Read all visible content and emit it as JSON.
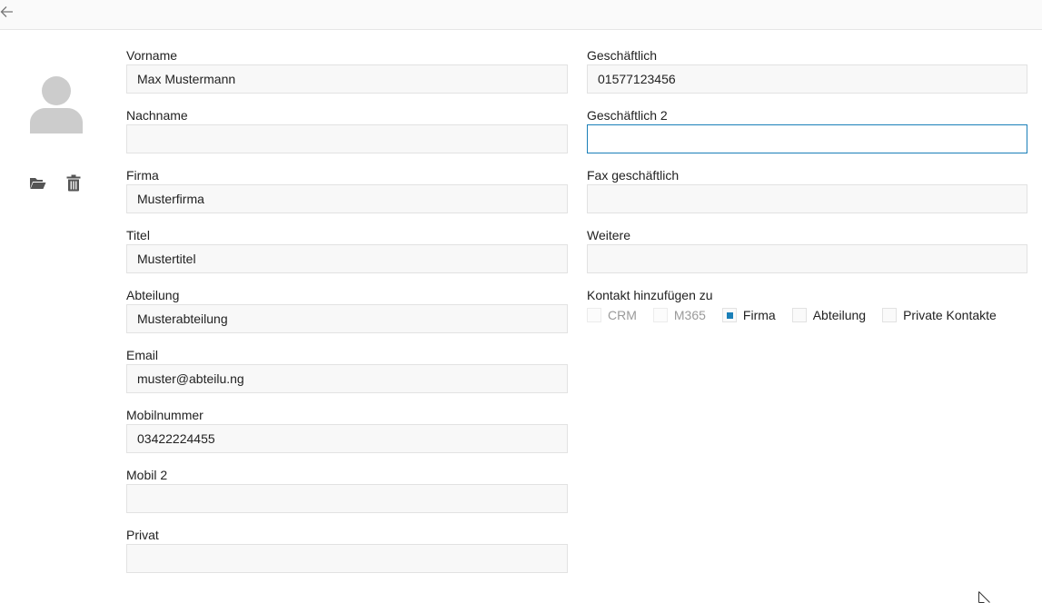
{
  "header": {
    "back_icon": "arrow-left-icon"
  },
  "avatar": {
    "icon": "user-avatar-icon",
    "color": "#cccccc"
  },
  "actions": {
    "upload_icon": "folder-open-icon",
    "delete_icon": "trash-icon"
  },
  "left_fields": [
    {
      "label": "Vorname",
      "value": "Max Mustermann"
    },
    {
      "label": "Nachname",
      "value": ""
    },
    {
      "label": "Firma",
      "value": "Musterfirma"
    },
    {
      "label": "Titel",
      "value": "Mustertitel"
    },
    {
      "label": "Abteilung",
      "value": "Musterabteilung"
    },
    {
      "label": "Email",
      "value": "muster@abteilu.ng"
    },
    {
      "label": "Mobilnummer",
      "value": "03422224455"
    },
    {
      "label": "Mobil 2",
      "value": ""
    },
    {
      "label": "Privat",
      "value": ""
    }
  ],
  "right_fields": [
    {
      "label": "Geschäftlich",
      "value": "01577123456"
    },
    {
      "label": "Geschäftlich 2",
      "value": "",
      "focused": true
    },
    {
      "label": "Fax geschäftlich",
      "value": ""
    },
    {
      "label": "Weitere",
      "value": ""
    }
  ],
  "contact_add": {
    "title": "Kontakt hinzufügen zu",
    "options": [
      {
        "label": "CRM",
        "checked": false,
        "disabled": true
      },
      {
        "label": "M365",
        "checked": false,
        "disabled": true
      },
      {
        "label": "Firma",
        "checked": true,
        "disabled": false
      },
      {
        "label": "Abteilung",
        "checked": false,
        "disabled": false
      },
      {
        "label": "Private Kontakte",
        "checked": false,
        "disabled": false
      }
    ]
  },
  "colors": {
    "accent": "#1a7fb8",
    "field_bg": "#f8f8f8",
    "field_border": "#e2e2e2"
  }
}
